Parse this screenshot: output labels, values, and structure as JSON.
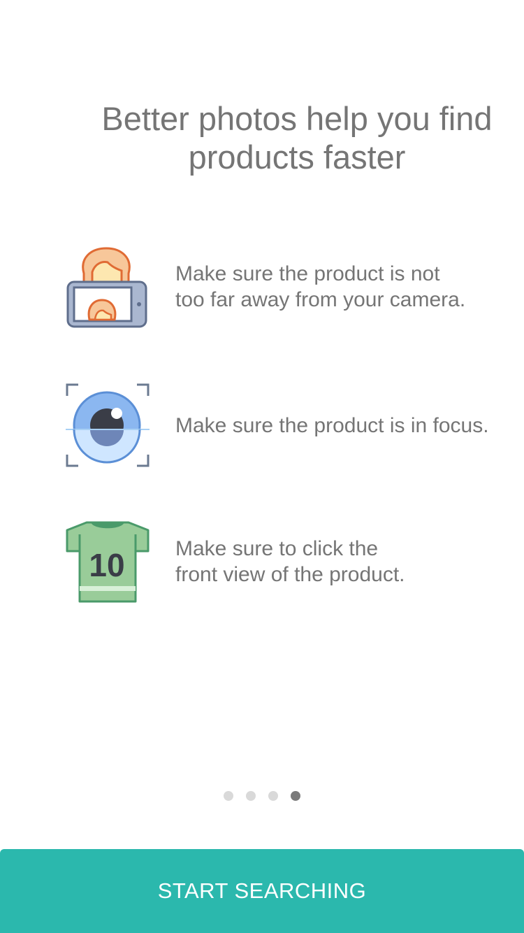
{
  "onboarding": {
    "title_line1": "Better photos help you find",
    "title_line2": "products faster",
    "tips": [
      {
        "icon": "selfie-phone-icon",
        "line1": "Make sure the product is not",
        "line2": "too far away from your camera."
      },
      {
        "icon": "focus-eye-icon",
        "line1": "Make sure the product is in focus.",
        "line2": ""
      },
      {
        "icon": "jersey-shirt-icon",
        "line1": "Make sure to click the",
        "line2": "front view of the product.",
        "shirt_number": "10"
      }
    ],
    "pagination": {
      "total": 4,
      "active_index": 3
    },
    "cta_label": "START SEARCHING"
  },
  "colors": {
    "accent": "#2bb8ad",
    "text": "#757575",
    "dot_inactive": "#d9d9d9",
    "dot_active": "#7a7a7a"
  }
}
